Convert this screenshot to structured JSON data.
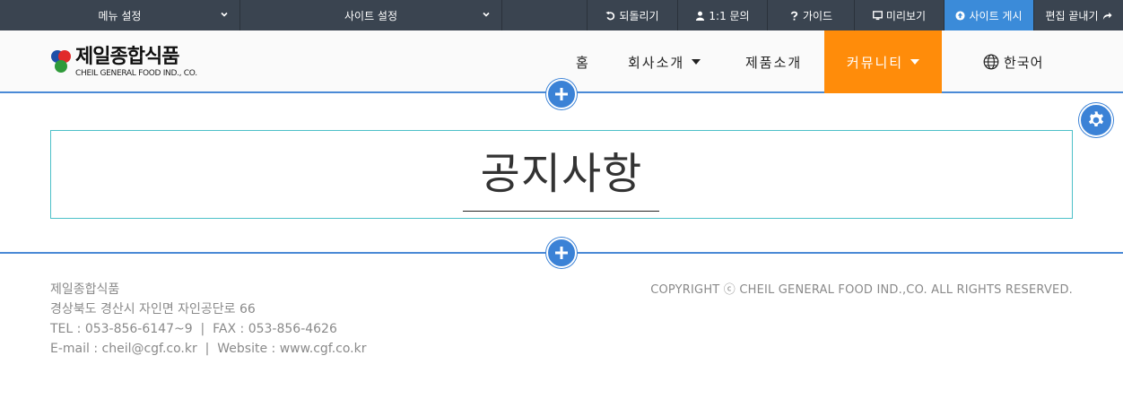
{
  "toolbar": {
    "menu_settings": "메뉴 설정",
    "site_settings": "사이트 설정",
    "undo": "되돌리기",
    "inquiry": "1:1 문의",
    "guide": "가이드",
    "preview": "미리보기",
    "publish": "사이트 게시",
    "end_edit": "편집 끝내기",
    "publish_color": "#3b8bd9"
  },
  "header": {
    "logo_name": "제일종합식품",
    "logo_eng": "CHEIL GENERAL FOOD IND., CO.",
    "nav": {
      "home": "홈",
      "about": "회사소개",
      "products": "제품소개",
      "community": "커뮤니티",
      "language": "한국어"
    },
    "active_color": "#ff8c0a"
  },
  "main": {
    "title": "공지사항"
  },
  "footer": {
    "company": "제일종합식품",
    "address": "경상북도 경산시 자인면 자인공단로 66",
    "phone_fax": "TEL : 053-856-6147~9  |  FAX : 053-856-4626",
    "email_web": "E-mail : cheil@cgf.co.kr  |  Website : www.cgf.co.kr",
    "copyright": "COPYRIGHT ⓒ CHEIL GENERAL FOOD IND.,CO. ALL RIGHTS RESERVED."
  }
}
